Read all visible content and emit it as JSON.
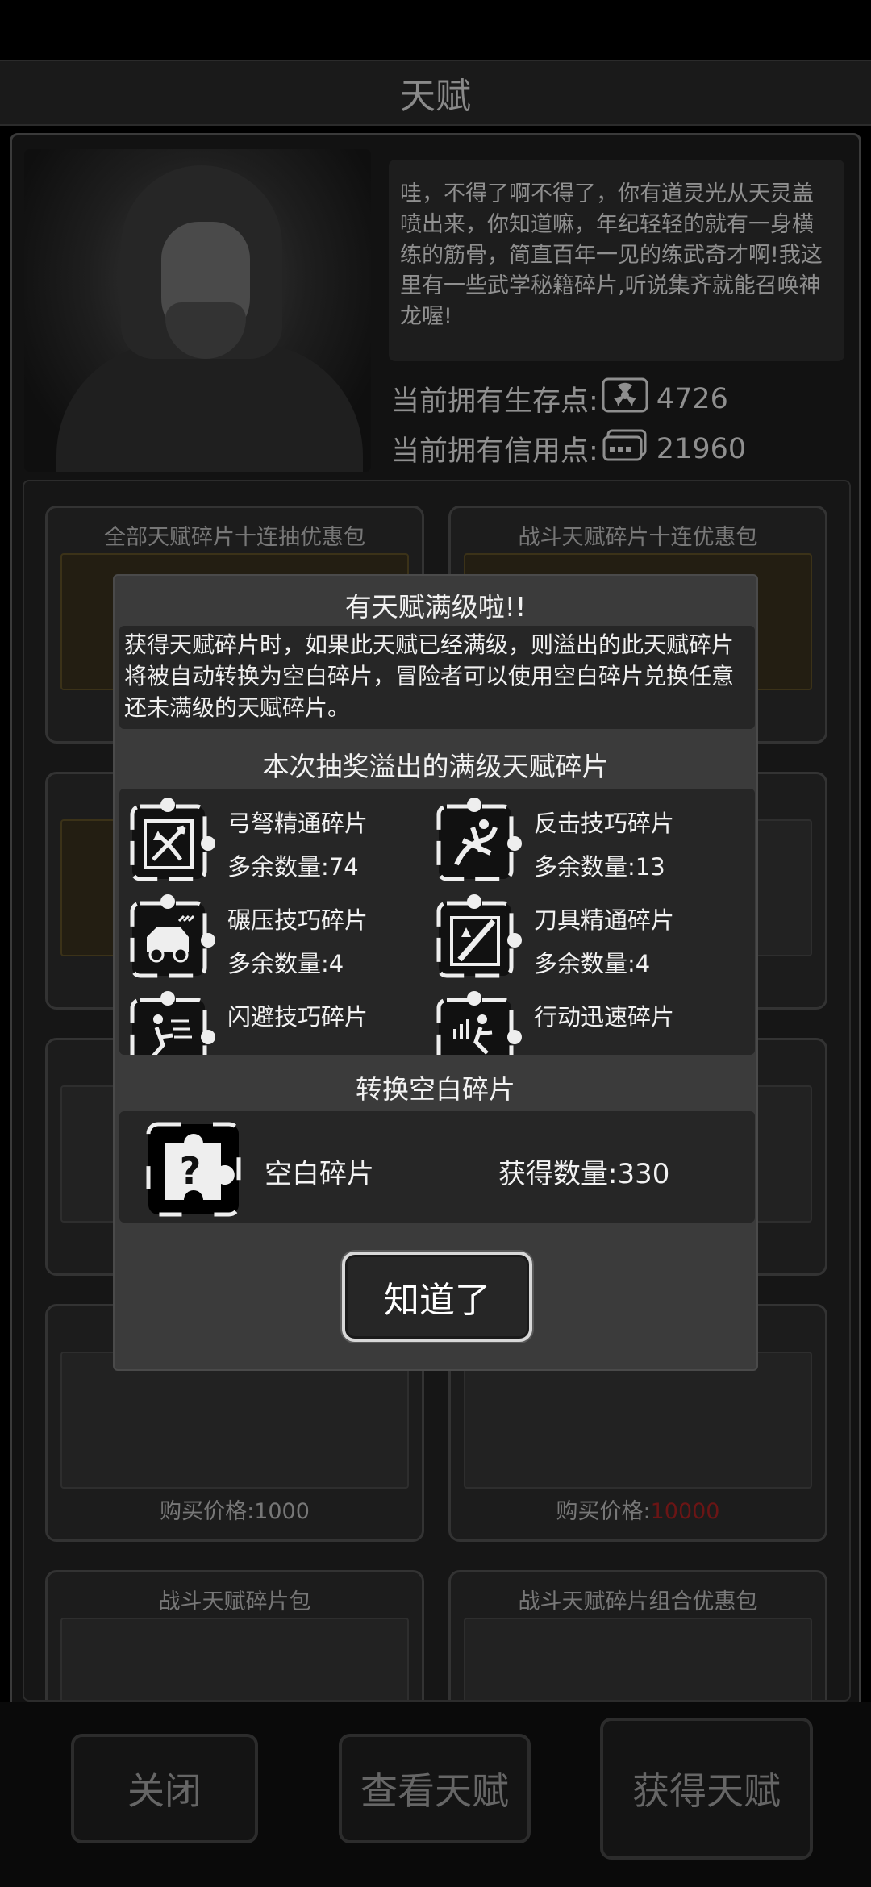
{
  "page_title": "天赋",
  "npc": {
    "speech": "哇，不得了啊不得了，你有道灵光从天灵盖喷出来，你知道嘛，年纪轻轻的就有一身横练的筋骨，简直百年一见的练武奇才啊!我这里有一些武学秘籍碎片,听说集齐就能召唤神龙喔!"
  },
  "points": {
    "survival_label": "当前拥有生存点:",
    "survival_value": "4726",
    "credit_label": "当前拥有信用点:",
    "credit_value": "21960"
  },
  "shop": {
    "cards": [
      {
        "name": "全部天赋碎片十连抽优惠包",
        "price": ""
      },
      {
        "name": "战斗天赋碎片十连优惠包",
        "price": ""
      },
      {
        "name": "",
        "price": ""
      },
      {
        "name": "",
        "price": ""
      },
      {
        "name": "",
        "price": ""
      },
      {
        "name": "",
        "price": ""
      },
      {
        "name": "",
        "price_label": "购买价格:",
        "price_value": "1000"
      },
      {
        "name": "",
        "price_label": "购买价格:",
        "price_value": "10000"
      },
      {
        "name": "战斗天赋碎片包",
        "price": ""
      },
      {
        "name": "战斗天赋碎片组合优惠包",
        "price": ""
      }
    ]
  },
  "bottom_buttons": {
    "close": "关闭",
    "view": "查看天赋",
    "obtain": "获得天赋"
  },
  "modal": {
    "title": "有天赋满级啦!!",
    "description": "获得天赋碎片时，如果此天赋已经满级，则溢出的此天赋碎片将被自动转换为空白碎片，冒险者可以使用空白碎片兑换任意还未满级的天赋碎片。",
    "overflow_title": "本次抽奖溢出的满级天赋碎片",
    "fragments": [
      {
        "name": "弓弩精通碎片",
        "count": "多余数量:74",
        "icon": "crossbow-icon"
      },
      {
        "name": "反击技巧碎片",
        "count": "多余数量:13",
        "icon": "counter-icon"
      },
      {
        "name": "碾压技巧碎片",
        "count": "多余数量:4",
        "icon": "crush-icon"
      },
      {
        "name": "刀具精通碎片",
        "count": "多余数量:4",
        "icon": "blade-icon"
      },
      {
        "name": "闪避技巧碎片",
        "count": "",
        "icon": "dodge-icon"
      },
      {
        "name": "行动迅速碎片",
        "count": "",
        "icon": "speed-icon"
      }
    ],
    "convert_title": "转换空白碎片",
    "blank": {
      "name": "空白碎片",
      "count": "获得数量:330",
      "icon": "question-puzzle-icon"
    },
    "ok_label": "知道了"
  },
  "colors": {
    "modal_bg": "#3b3b3b",
    "modal_inner": "#262626",
    "price_red": "#6b1515"
  }
}
